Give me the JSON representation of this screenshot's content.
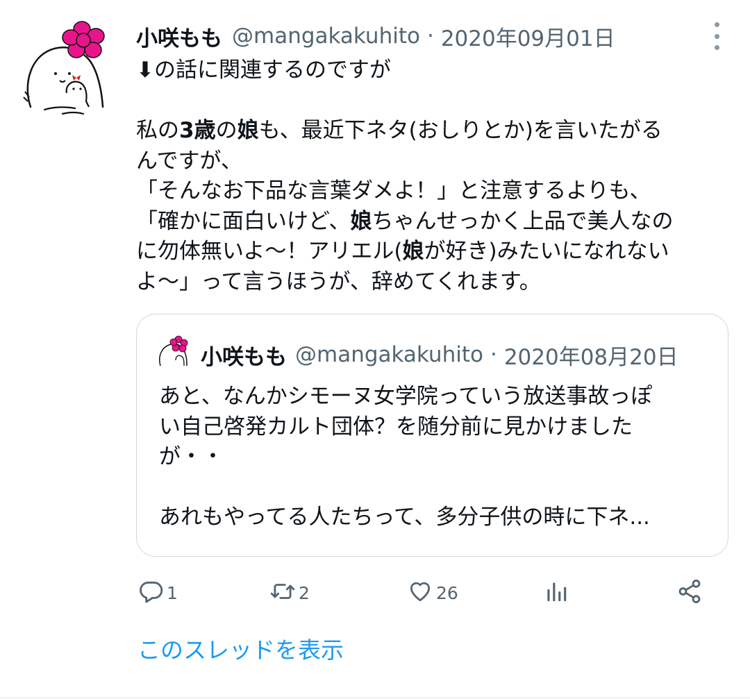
{
  "tweet": {
    "author_name": "小咲もも",
    "handle": "@mangakakuhito",
    "separator": "·",
    "date": "2020年09月01日",
    "text": {
      "l1": "⬇の話に関連するのですが",
      "l3a": "私の",
      "l3b": "3歳",
      "l3c": "の",
      "l3d": "娘",
      "l3e": "も、最近下ネタ(おしりとか)を言いたがる",
      "l4": "んですが、",
      "l5": "「そんなお下品な言葉ダメよ！」と注意するよりも、",
      "l6a": "「確かに面白いけど、",
      "l6b": "娘",
      "l6c": "ちゃんせっかく上品で美人なの",
      "l7a": "に勿体無いよ〜！アリエル(",
      "l7b": "娘",
      "l7c": "が好き)みたいになれない",
      "l8": "よ〜」って言うほうが、辞めてくれます。"
    }
  },
  "quote": {
    "author_name": "小咲もも",
    "handle": "@mangakakuhito",
    "separator": "·",
    "date": "2020年08月20日",
    "lines": [
      "あと、なんかシモーヌ女学院っていう放送事故っぽ",
      "い自己啓発カルト団体？を随分前に見かけました",
      "が・・",
      "",
      "あれもやってる人たちって、多分子供の時に下ネ..."
    ]
  },
  "actions": {
    "reply_count": "1",
    "retweet_count": "2",
    "like_count": "26"
  },
  "thread_link": "このスレッドを表示",
  "icons": {
    "reply": "speech-bubble-icon",
    "retweet": "retweet-arrows-icon",
    "like": "heart-icon",
    "analytics": "bar-chart-icon",
    "share": "share-nodes-icon",
    "more": "vertical-dots-icon"
  },
  "colors": {
    "text": "#0f1419",
    "secondary": "#536471",
    "link": "#1d9bf0",
    "border": "#cfd9de",
    "avatar_flower": "#e8148c"
  }
}
